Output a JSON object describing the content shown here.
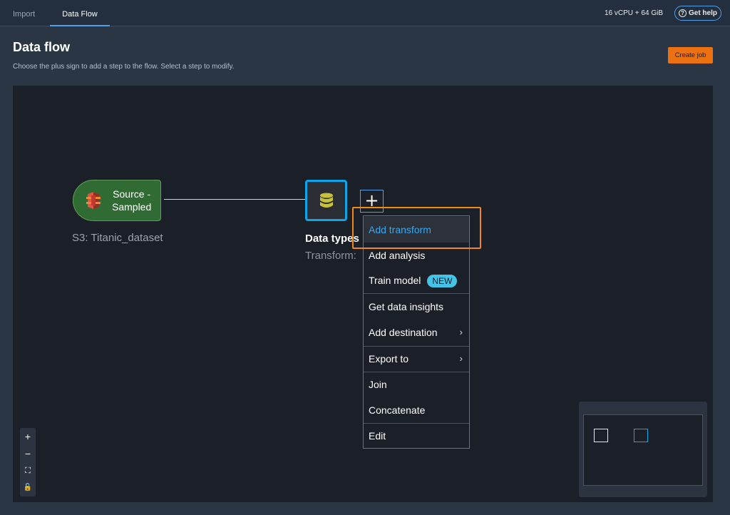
{
  "tabs": [
    {
      "label": "Import",
      "active": false
    },
    {
      "label": "Data Flow",
      "active": true
    }
  ],
  "resources": "16 vCPU + 64 GiB",
  "help": {
    "label": "Get help",
    "icon": "question-circle-icon"
  },
  "page": {
    "title": "Data flow",
    "subtitle": "Choose the plus sign to add a step to the flow. Select a step to modify.",
    "create_job_label": "Create job"
  },
  "flow": {
    "source": {
      "label_line1": "Source -",
      "label_line2": "Sampled",
      "caption": "S3: Titanic_dataset",
      "icon": "s3-bucket-icon"
    },
    "data_types": {
      "title": "Data types",
      "subtitle": "Transform:",
      "icon": "database-icon"
    },
    "add_step_symbol": "+"
  },
  "menu": {
    "items": [
      {
        "label": "Add transform",
        "active": true
      },
      {
        "label": "Add analysis"
      },
      {
        "label": "Train model",
        "badge": "NEW"
      },
      {
        "label": "Get data insights"
      },
      {
        "label": "Add destination",
        "submenu": true
      },
      {
        "label": "Export to",
        "submenu": true
      },
      {
        "label": "Join"
      },
      {
        "label": "Concatenate"
      },
      {
        "label": "Edit"
      }
    ],
    "chevron": "›"
  },
  "zoom_controls": {
    "zoom_in": "+",
    "zoom_out": "−",
    "fit": "⛶",
    "lock": "🔓"
  },
  "colors": {
    "accent": "#539fe5",
    "primary_button": "#ec7211",
    "highlight": "#f0881a",
    "selected_node": "#0ea5e9",
    "source_node": "#2f6b33"
  }
}
